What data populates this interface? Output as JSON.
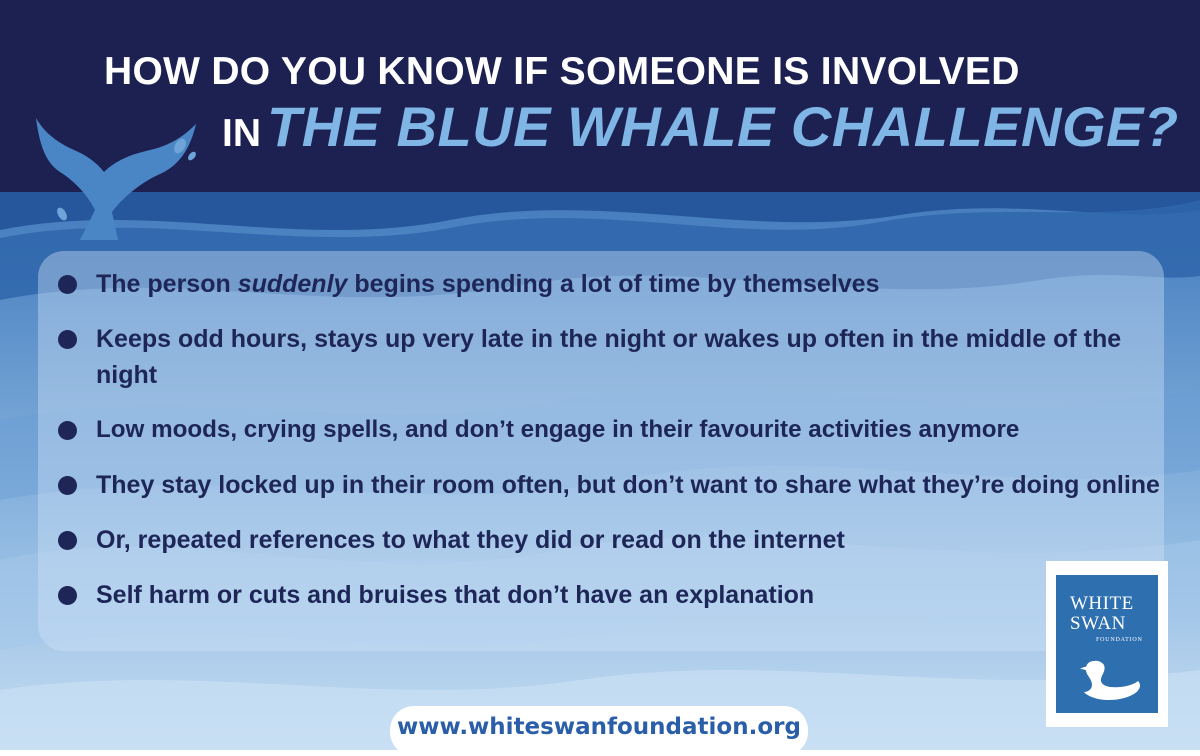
{
  "title": {
    "line1": "HOW DO YOU KNOW IF SOMEONE IS INVOLVED",
    "line2_prefix": "IN",
    "line2_highlight": "THE BLUE WHALE CHALLENGE?"
  },
  "signs": [
    {
      "before": "The person ",
      "emphasis": "suddenly",
      "after": " begins spending a lot of time by themselves"
    },
    {
      "text": "Keeps odd hours, stays up very late in the night or wakes up often in the middle of the night"
    },
    {
      "text": "Low moods, crying spells, and don’t engage in their favourite activities anymore"
    },
    {
      "text": "They stay locked up in their room often, but don’t want to share what they’re doing online"
    },
    {
      "text": "Or, repeated references to what they did or read on the internet"
    },
    {
      "text": "Self harm or cuts and bruises that don’t have an explanation"
    }
  ],
  "logo": {
    "line1": "WHITE",
    "line2": "SWAN",
    "line3": "FOUNDATION"
  },
  "url": "www.whiteswanfoundation.org",
  "colors": {
    "header_navy": "#1d2151",
    "highlight_blue": "#7fb6e6",
    "bullet_text": "#1e2658",
    "logo_blue": "#2e6fb0",
    "url_blue": "#2a5ea8"
  },
  "icons": [
    "whale-tail-icon",
    "water-splash-icon",
    "bullet-icon",
    "swan-icon"
  ]
}
